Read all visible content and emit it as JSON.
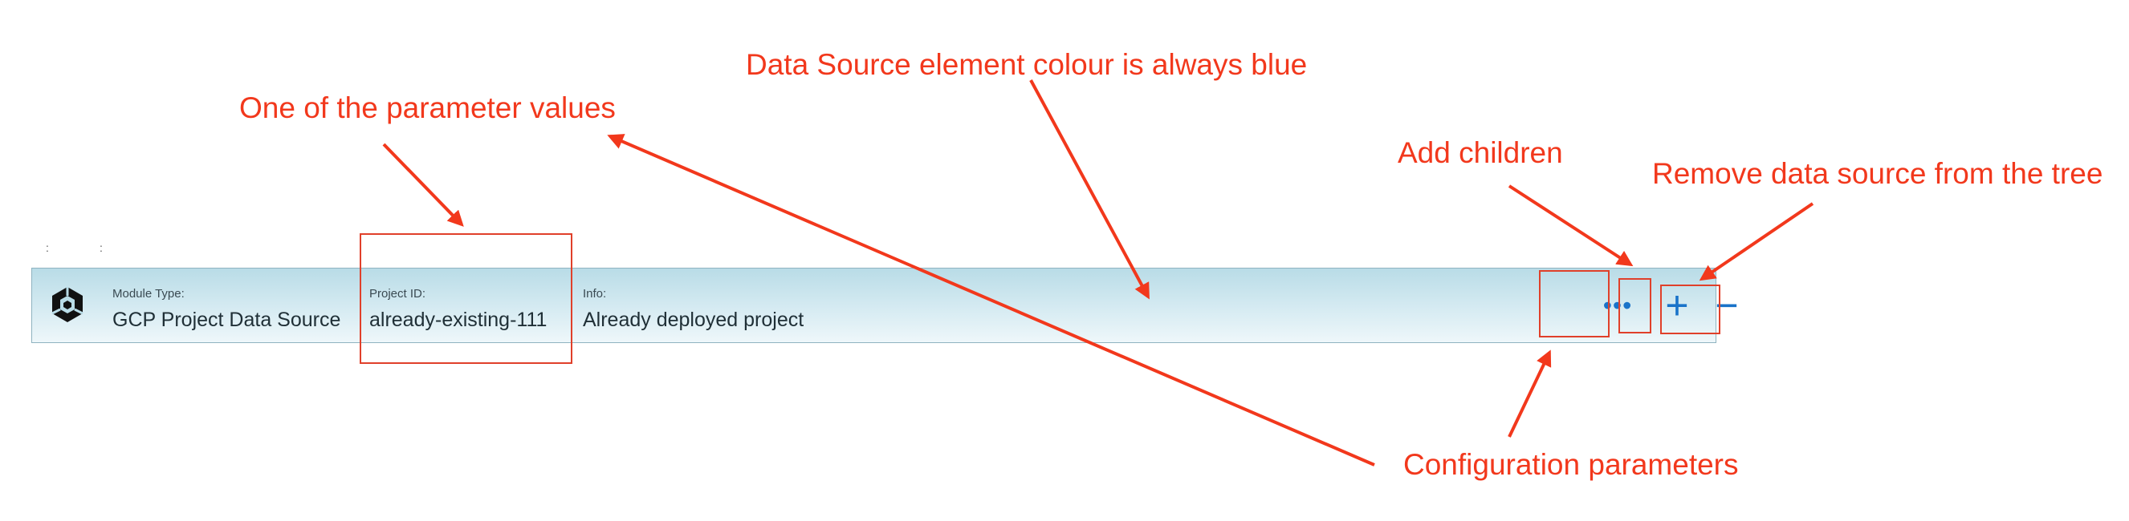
{
  "column_dots": [
    ":",
    ":"
  ],
  "row": {
    "module_type_label": "Module Type:",
    "module_type_value": "GCP Project Data Source",
    "project_id_label": "Project ID:",
    "project_id_value": "already-existing-111",
    "info_label": "Info:",
    "info_value": "Already deployed project",
    "background_color": "#c9e4ee",
    "icon": "gcp-hexagon-icon"
  },
  "actions": {
    "more_label": "•••",
    "add_label": "+",
    "remove_label": "−",
    "accent_color": "#1a73c9"
  },
  "annotations": {
    "color": "#f2381c",
    "parameter_value": "One of the parameter values",
    "blue_colour": "Data Source element colour is always blue",
    "add_children": "Add children",
    "remove_source": "Remove data source from the tree",
    "configuration": "Configuration parameters"
  }
}
